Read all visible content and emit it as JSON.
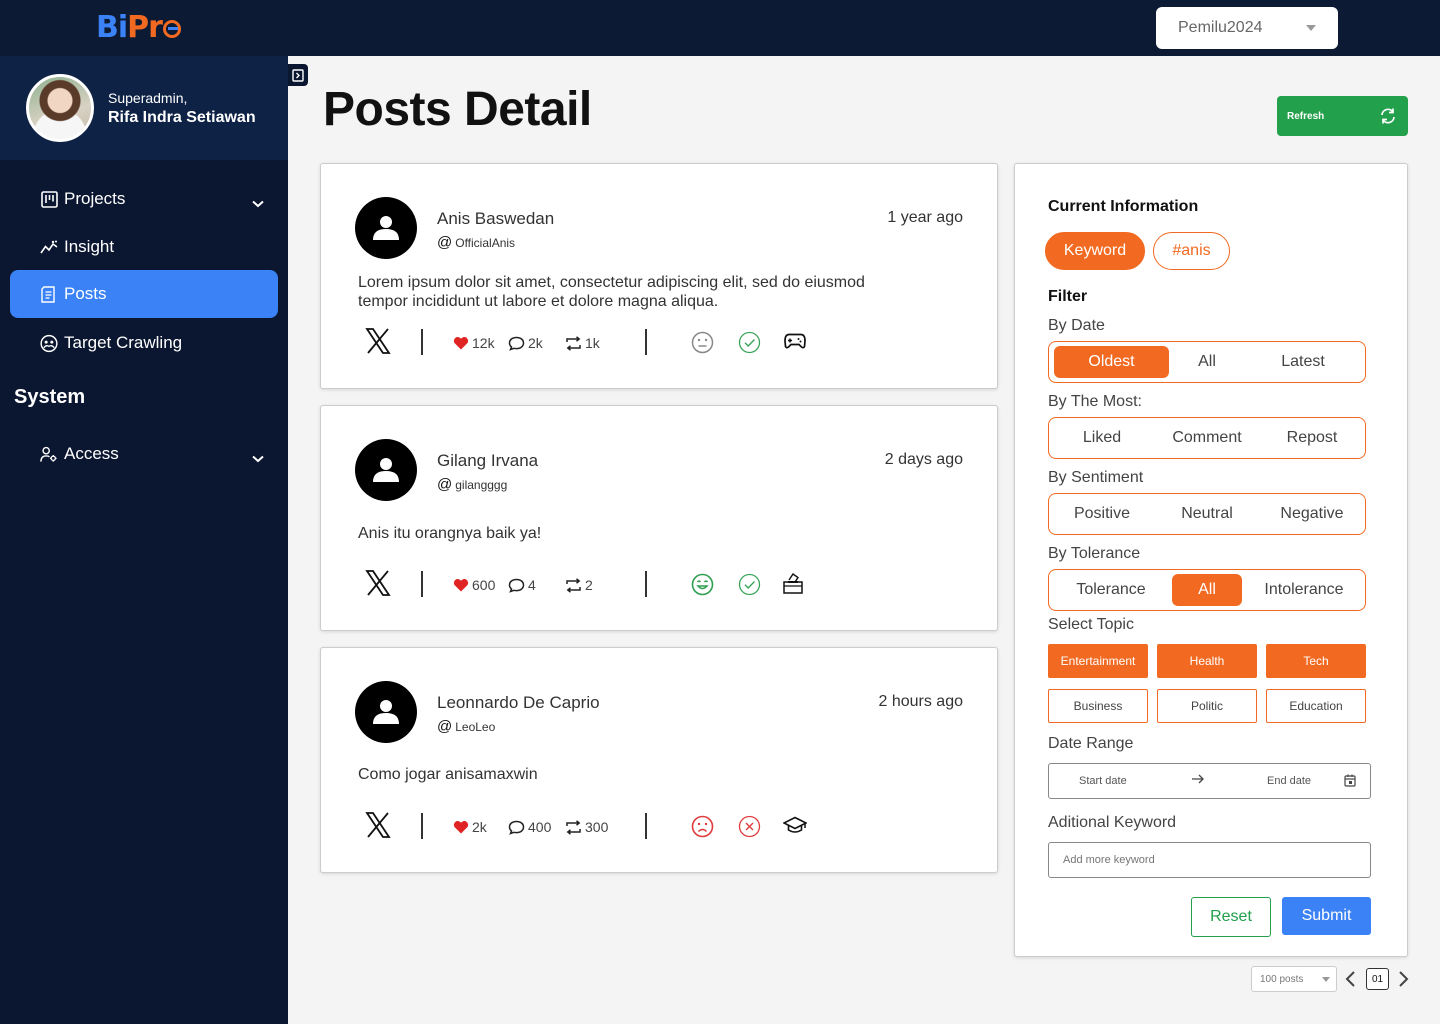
{
  "app": {
    "logo_left": "Bi",
    "logo_right": "Pr"
  },
  "project_select": {
    "value": "Pemilu2024"
  },
  "user": {
    "role": "Superadmin,",
    "name": "Rifa Indra Setiawan"
  },
  "nav": {
    "items": [
      {
        "label": "Projects",
        "icon": "kanban-icon",
        "has_chevron": true
      },
      {
        "label": "Insight",
        "icon": "chart-line-icon"
      },
      {
        "label": "Posts",
        "icon": "document-icon",
        "active": true
      },
      {
        "label": "Target Crawling",
        "icon": "target-icon"
      }
    ],
    "section_title": "System",
    "system_items": [
      {
        "label": "Access",
        "icon": "user-gear-icon",
        "has_chevron": true
      }
    ]
  },
  "page": {
    "title": "Posts Detail",
    "refresh_label": "Refresh"
  },
  "posts": [
    {
      "name": "Anis Baswedan",
      "handle": "OfficialAnis",
      "time": "1 year ago",
      "body": "Lorem ipsum dolor sit amet, consectetur adipiscing elit, sed do eiusmod tempor incididunt ut labore et dolore magna aliqua.",
      "likes": "12k",
      "comments": "2k",
      "reposts": "1k",
      "sentiment": "neutral",
      "tolerance": "tolerance",
      "topic_icon": "gamepad-icon"
    },
    {
      "name": "Gilang Irvana",
      "handle": "gilangggg",
      "time": "2 days ago",
      "body": "Anis itu orangnya baik ya!",
      "likes": "600",
      "comments": "4",
      "reposts": "2",
      "sentiment": "positive",
      "tolerance": "tolerance",
      "topic_icon": "ballot-box-icon"
    },
    {
      "name": "Leonnardo De Caprio",
      "handle": "LeoLeo",
      "time": "2 hours ago",
      "body": "Como jogar anisamaxwin",
      "likes": "2k",
      "comments": "400",
      "reposts": "300",
      "sentiment": "negative",
      "tolerance": "intolerance",
      "topic_icon": "graduation-cap-icon"
    }
  ],
  "filter": {
    "current_info_title": "Current Information",
    "chips": [
      "Keyword",
      "#anis"
    ],
    "filter_title": "Filter",
    "by_date": {
      "label": "By Date",
      "options": [
        "Oldest",
        "All",
        "Latest"
      ],
      "selected": "Oldest"
    },
    "by_most": {
      "label": "By The Most:",
      "options": [
        "Liked",
        "Comment",
        "Repost"
      ]
    },
    "by_sentiment": {
      "label": "By Sentiment",
      "options": [
        "Positive",
        "Neutral",
        "Negative"
      ]
    },
    "by_tolerance": {
      "label": "By Tolerance",
      "options": [
        "Tolerance",
        "All",
        "Intolerance"
      ],
      "selected": "All"
    },
    "topic": {
      "label": "Select Topic",
      "options": [
        "Entertainment",
        "Health",
        "Tech",
        "Business",
        "Politic",
        "Education"
      ],
      "selected": [
        "Entertainment",
        "Health",
        "Tech"
      ]
    },
    "date_range": {
      "label": "Date Range",
      "start_placeholder": "Start date",
      "end_placeholder": "End date"
    },
    "keyword": {
      "label": "Aditional Keyword",
      "placeholder": "Add more keyword"
    },
    "reset_label": "Reset",
    "submit_label": "Submit"
  },
  "pagination": {
    "per_page": "100 posts",
    "page": "01"
  },
  "colors": {
    "accent": "#f26a21",
    "primary": "#3b82f6",
    "success": "#22a04b",
    "nav_bg": "#0b1630",
    "danger": "#e03a3a"
  }
}
